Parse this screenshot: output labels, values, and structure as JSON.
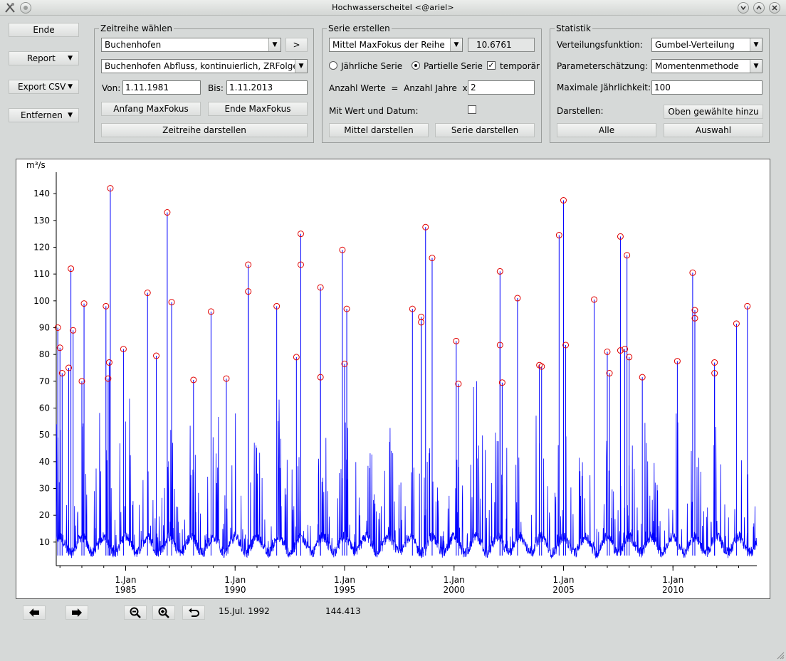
{
  "window": {
    "title": "Hochwasserscheitel <@ariel>"
  },
  "left_buttons": {
    "ende": "Ende",
    "report": "Report",
    "export_csv": "Export CSV",
    "entfernen": "Entfernen"
  },
  "zeitreihe": {
    "group_title": "Zeitreihe wählen",
    "station": "Buchenhofen",
    "next_label": ">",
    "series": "Buchenhofen  Abfluss, kontinuierlich, ZRFolge, P",
    "von_label": "Von:",
    "von_value": "1.11.1981",
    "bis_label": "Bis:",
    "bis_value": "1.11.2013",
    "anfang_btn": "Anfang MaxFokus",
    "ende_btn": "Ende MaxFokus",
    "darstellen_btn": "Zeitreihe darstellen"
  },
  "serie": {
    "group_title": "Serie erstellen",
    "method": "Mittel MaxFokus der Reihe",
    "method_value": "10.6761",
    "radio_jaehrlich": "Jährliche Serie",
    "radio_partiell": "Partielle Serie",
    "temporaer": "temporär",
    "anzahl_label": "Anzahl Werte  =  Anzahl Jahre  x",
    "anzahl_value": "2",
    "mit_wert_label": "Mit Wert und Datum:",
    "mittel_btn": "Mittel darstellen",
    "serie_btn": "Serie darstellen"
  },
  "statistik": {
    "group_title": "Statistik",
    "vert_label": "Verteilungsfunktion:",
    "vert_value": "Gumbel-Verteilung",
    "param_label": "Parameterschätzung:",
    "param_value": "Momentenmethode",
    "max_label": "Maximale Jährlichkeit:",
    "max_value": "100",
    "darstellen_label": "Darstellen:",
    "oben_btn": "Oben gewählte hinzu",
    "alle_btn": "Alle",
    "auswahl_btn": "Auswahl"
  },
  "status": {
    "date": "15.Jul. 1992",
    "value": "144.413"
  },
  "icons": [
    "left-arrow-icon",
    "right-arrow-icon",
    "zoom-out-icon",
    "zoom-in-icon",
    "undo-icon"
  ],
  "colors": {
    "series_line": "#0000ff",
    "peak_marker": "#e00000"
  },
  "chart_data": {
    "type": "line",
    "ylabel": "m³/s",
    "ylim": [
      2,
      148
    ],
    "y_ticks": [
      10,
      20,
      30,
      40,
      50,
      60,
      70,
      80,
      90,
      100,
      110,
      120,
      130,
      140
    ],
    "xlim": [
      1981.83,
      2013.83
    ],
    "x_ticks": [
      {
        "value": 1985,
        "line1": "1.Jan",
        "line2": "1985"
      },
      {
        "value": 1990,
        "line1": "1.Jan",
        "line2": "1990"
      },
      {
        "value": 1995,
        "line1": "1.Jan",
        "line2": "1995"
      },
      {
        "value": 2000,
        "line1": "1.Jan",
        "line2": "2000"
      },
      {
        "value": 2005,
        "line1": "1.Jan",
        "line2": "2005"
      },
      {
        "value": 2010,
        "line1": "1.Jan",
        "line2": "2010"
      }
    ],
    "peaks": [
      {
        "x": 1981.9,
        "y": 90
      },
      {
        "x": 1982.0,
        "y": 82.5
      },
      {
        "x": 1982.1,
        "y": 73
      },
      {
        "x": 1982.4,
        "y": 75
      },
      {
        "x": 1982.5,
        "y": 112
      },
      {
        "x": 1982.6,
        "y": 89
      },
      {
        "x": 1983.0,
        "y": 70
      },
      {
        "x": 1983.1,
        "y": 99
      },
      {
        "x": 1984.1,
        "y": 98
      },
      {
        "x": 1984.2,
        "y": 71
      },
      {
        "x": 1984.25,
        "y": 77
      },
      {
        "x": 1984.3,
        "y": 142
      },
      {
        "x": 1984.9,
        "y": 82
      },
      {
        "x": 1986.0,
        "y": 103
      },
      {
        "x": 1986.4,
        "y": 79.5
      },
      {
        "x": 1986.9,
        "y": 133
      },
      {
        "x": 1987.1,
        "y": 99.5
      },
      {
        "x": 1988.1,
        "y": 70.5
      },
      {
        "x": 1988.9,
        "y": 96
      },
      {
        "x": 1989.6,
        "y": 71
      },
      {
        "x": 1990.6,
        "y": 113.5
      },
      {
        "x": 1990.6,
        "y": 103.5
      },
      {
        "x": 1991.9,
        "y": 98
      },
      {
        "x": 1992.8,
        "y": 79
      },
      {
        "x": 1993.0,
        "y": 125
      },
      {
        "x": 1993.0,
        "y": 113.5
      },
      {
        "x": 1993.9,
        "y": 105
      },
      {
        "x": 1993.9,
        "y": 71.5
      },
      {
        "x": 1994.9,
        "y": 119
      },
      {
        "x": 1995.0,
        "y": 76.5
      },
      {
        "x": 1995.1,
        "y": 97
      },
      {
        "x": 1998.1,
        "y": 97
      },
      {
        "x": 1998.5,
        "y": 94
      },
      {
        "x": 1998.5,
        "y": 92
      },
      {
        "x": 1998.7,
        "y": 127.5
      },
      {
        "x": 1999.0,
        "y": 116
      },
      {
        "x": 2000.1,
        "y": 85
      },
      {
        "x": 2000.2,
        "y": 69
      },
      {
        "x": 2002.1,
        "y": 111
      },
      {
        "x": 2002.1,
        "y": 83.5
      },
      {
        "x": 2002.2,
        "y": 69.5
      },
      {
        "x": 2002.9,
        "y": 101
      },
      {
        "x": 2003.9,
        "y": 76
      },
      {
        "x": 2004.0,
        "y": 75.5
      },
      {
        "x": 2004.8,
        "y": 124.5
      },
      {
        "x": 2005.0,
        "y": 137.5
      },
      {
        "x": 2005.1,
        "y": 83.5
      },
      {
        "x": 2006.4,
        "y": 100.5
      },
      {
        "x": 2007.0,
        "y": 81
      },
      {
        "x": 2007.1,
        "y": 73
      },
      {
        "x": 2007.6,
        "y": 124
      },
      {
        "x": 2007.6,
        "y": 81.5
      },
      {
        "x": 2007.8,
        "y": 82
      },
      {
        "x": 2007.9,
        "y": 117
      },
      {
        "x": 2008.0,
        "y": 79
      },
      {
        "x": 2008.6,
        "y": 71.5
      },
      {
        "x": 2010.2,
        "y": 77.5
      },
      {
        "x": 2010.9,
        "y": 110.5
      },
      {
        "x": 2011.0,
        "y": 96.5
      },
      {
        "x": 2011.0,
        "y": 93.5
      },
      {
        "x": 2011.9,
        "y": 77
      },
      {
        "x": 2011.9,
        "y": 73
      },
      {
        "x": 2012.9,
        "y": 91.5
      },
      {
        "x": 2013.4,
        "y": 98
      }
    ]
  }
}
